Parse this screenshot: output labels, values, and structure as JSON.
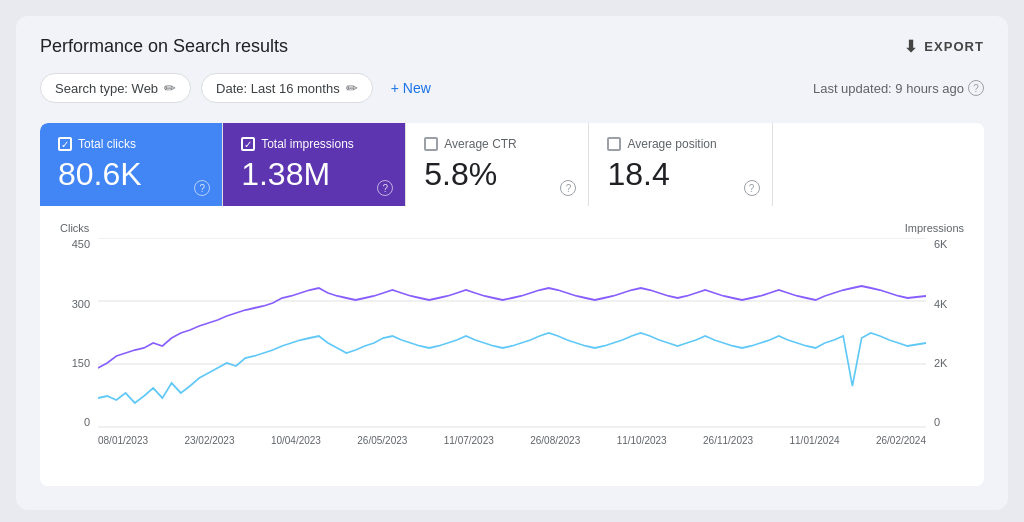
{
  "page": {
    "title": "Performance on Search results",
    "export_label": "EXPORT"
  },
  "filters": {
    "search_type_label": "Search type: Web",
    "date_label": "Date: Last 16 months",
    "new_label": "New",
    "last_updated": "Last updated: 9 hours ago"
  },
  "metrics": [
    {
      "id": "total-clicks",
      "label": "Total clicks",
      "value": "80.6K",
      "active": true,
      "color": "blue"
    },
    {
      "id": "total-impressions",
      "label": "Total impressions",
      "value": "1.38M",
      "active": true,
      "color": "purple"
    },
    {
      "id": "average-ctr",
      "label": "Average CTR",
      "value": "5.8%",
      "active": false,
      "color": "none"
    },
    {
      "id": "average-position",
      "label": "Average position",
      "value": "18.4",
      "active": false,
      "color": "none"
    }
  ],
  "chart": {
    "y_axis_left_label": "Clicks",
    "y_axis_right_label": "Impressions",
    "y_left_ticks": [
      "450",
      "300",
      "150",
      "0"
    ],
    "y_right_ticks": [
      "6K",
      "4K",
      "2K",
      "0"
    ],
    "x_ticks": [
      "08/01/2023",
      "23/02/2023",
      "10/04/2023",
      "26/05/2023",
      "11/07/2023",
      "26/08/2023",
      "11/10/2023",
      "26/11/2023",
      "11/01/2024",
      "26/02/2024"
    ]
  },
  "icons": {
    "export": "⬇",
    "edit": "✏",
    "plus": "+",
    "help": "?",
    "check": "✓"
  }
}
